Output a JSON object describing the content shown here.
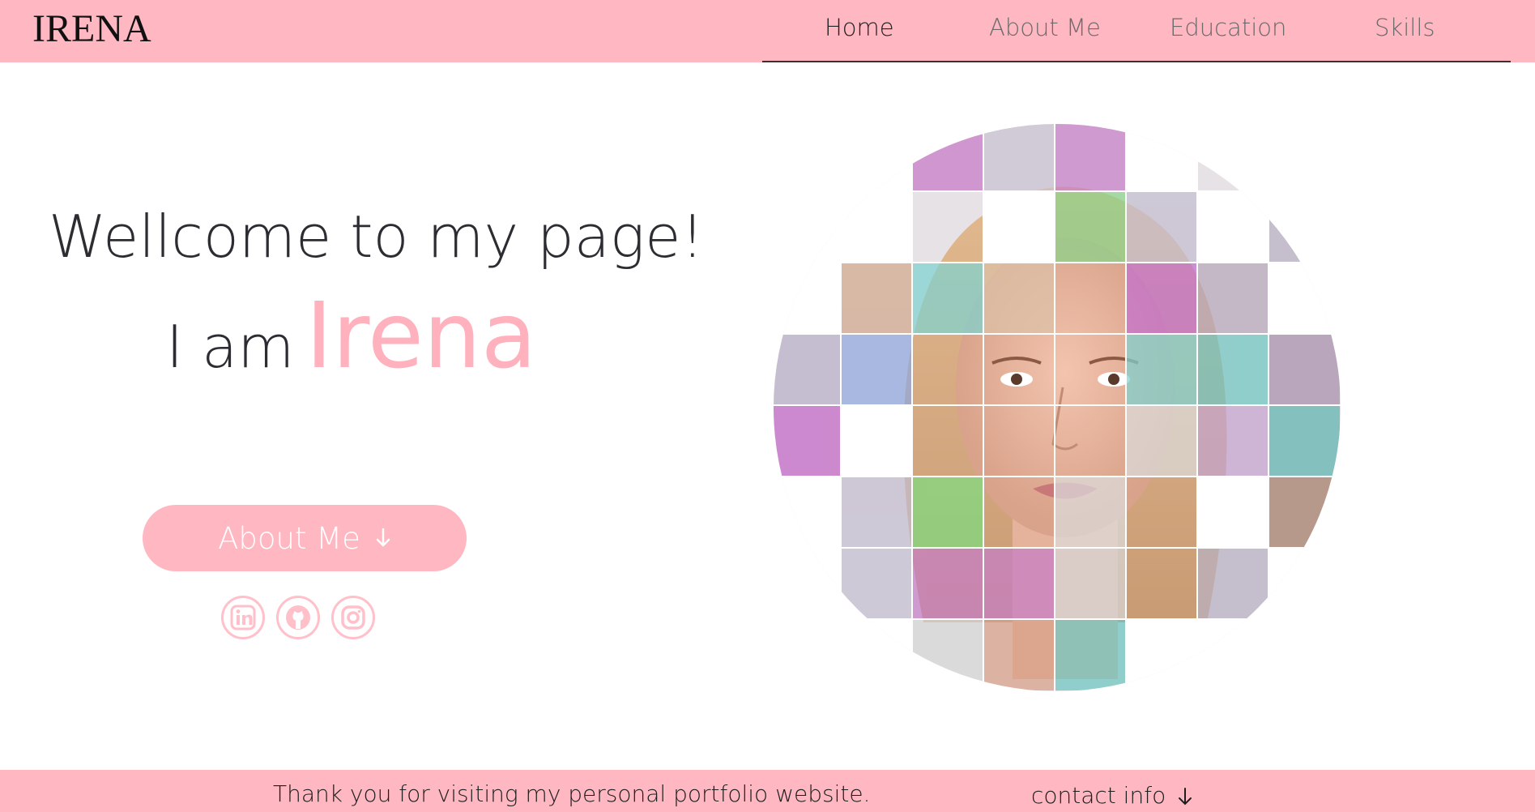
{
  "header": {
    "logo": "IRENA",
    "nav": [
      {
        "label": "Home",
        "active": true
      },
      {
        "label": "About Me",
        "active": false
      },
      {
        "label": "Education",
        "active": false
      },
      {
        "label": "Skills",
        "active": false
      }
    ]
  },
  "hero": {
    "greeting": "Wellcome to my page!",
    "intro": "I am",
    "name": "Irena",
    "button_label": "About Me",
    "button_icon": "arrow-down-icon",
    "socials": [
      {
        "icon": "linkedin-icon"
      },
      {
        "icon": "github-icon"
      },
      {
        "icon": "instagram-icon"
      }
    ]
  },
  "footer": {
    "message": "Thank you for visiting my personal portfolio website.",
    "contact_label": "contact info",
    "contact_icon": "arrow-down-icon"
  },
  "colors": {
    "accent_pink": "#ffb7c2",
    "name_pink": "#ffb1bd",
    "text_dark": "#2b2d33"
  }
}
